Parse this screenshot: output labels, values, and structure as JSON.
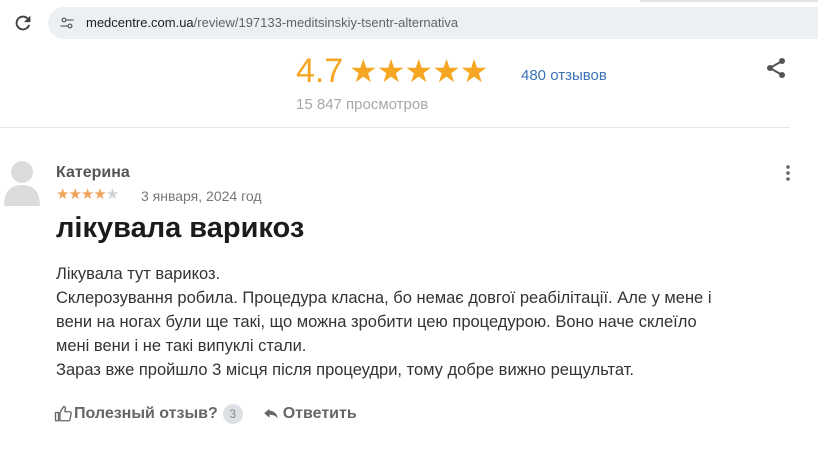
{
  "browser": {
    "url_host": "medcentre.com.ua",
    "url_path": "/review/197133-meditsinskiy-tsentr-alternativa"
  },
  "rating": {
    "score": "4.7",
    "stars": "★★★★★",
    "reviews_link": "480 отзывов",
    "views": "15 847 просмотров"
  },
  "review": {
    "author": "Катерина",
    "rating_stars": 4,
    "stars_filled": "★★★★",
    "stars_empty": "★",
    "date": "3 января, 2024 год",
    "title": "лікувала варикоз",
    "body_lines": [
      "Лікувала тут варикоз.",
      "Склерозування робила. Процедура класна, бо немає довгої реабілітації. Але у мене і",
      "вени на ногах були ще такі, що можна зробити цею процедурою. Воно наче склеїло",
      "мені вени і не такі випуклі стали.",
      "Зараз вже пройшло 3 місця після процеудри, тому добре вижно рещультат."
    ]
  },
  "actions": {
    "helpful_label": "Полезный отзыв?",
    "helpful_count": "3",
    "reply_label": "Ответить"
  },
  "colors": {
    "star_gold": "#f5a623",
    "star_small": "#f0a35a",
    "link_blue": "#3a74b7"
  },
  "icons": {
    "reload": "reload-icon",
    "site_info": "site-info-icon",
    "share": "share-icon",
    "more": "more-vertical-icon",
    "avatar": "user-avatar-icon",
    "thumbs_up": "thumbs-up-icon",
    "reply": "reply-arrow-icon"
  }
}
